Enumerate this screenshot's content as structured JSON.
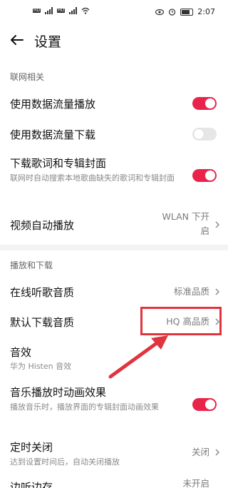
{
  "status_bar": {
    "left_tag": "HD",
    "time": "2:07"
  },
  "header": {
    "title": "设置"
  },
  "sections": {
    "network": "联网相关",
    "playback": "播放和下载"
  },
  "rows": {
    "data_play": {
      "label": "使用数据流量播放",
      "toggle": true
    },
    "data_download": {
      "label": "使用数据流量下载",
      "toggle": false
    },
    "lyrics_cover": {
      "label": "下载歌词和专辑封面",
      "sub": "联网时自动搜索本地歌曲缺失的歌词和专辑封面",
      "toggle": true
    },
    "video_autoplay": {
      "label": "视频自动播放",
      "value_line1": "WLAN 下开",
      "value_line2": "启"
    },
    "online_quality": {
      "label": "在线听歌音质",
      "value": "标准品质"
    },
    "download_quality": {
      "label": "默认下载音质",
      "value": "HQ 高品质"
    },
    "sound_effect": {
      "label": "音效",
      "sub": "华为 Histen 音效"
    },
    "anim_effect": {
      "label": "音乐播放时动画效果",
      "sub": "播放音乐时，播放界面的专辑封面动画效果",
      "toggle": true
    },
    "timer_close": {
      "label": "定时关闭",
      "sub": "达到设置时间后，自动关闭播放",
      "value": "关闭"
    },
    "partial_last": {
      "label": "边听边存",
      "value": "未开启"
    }
  },
  "colors": {
    "accent": "#e8244b",
    "annotation": "#e0343f"
  }
}
